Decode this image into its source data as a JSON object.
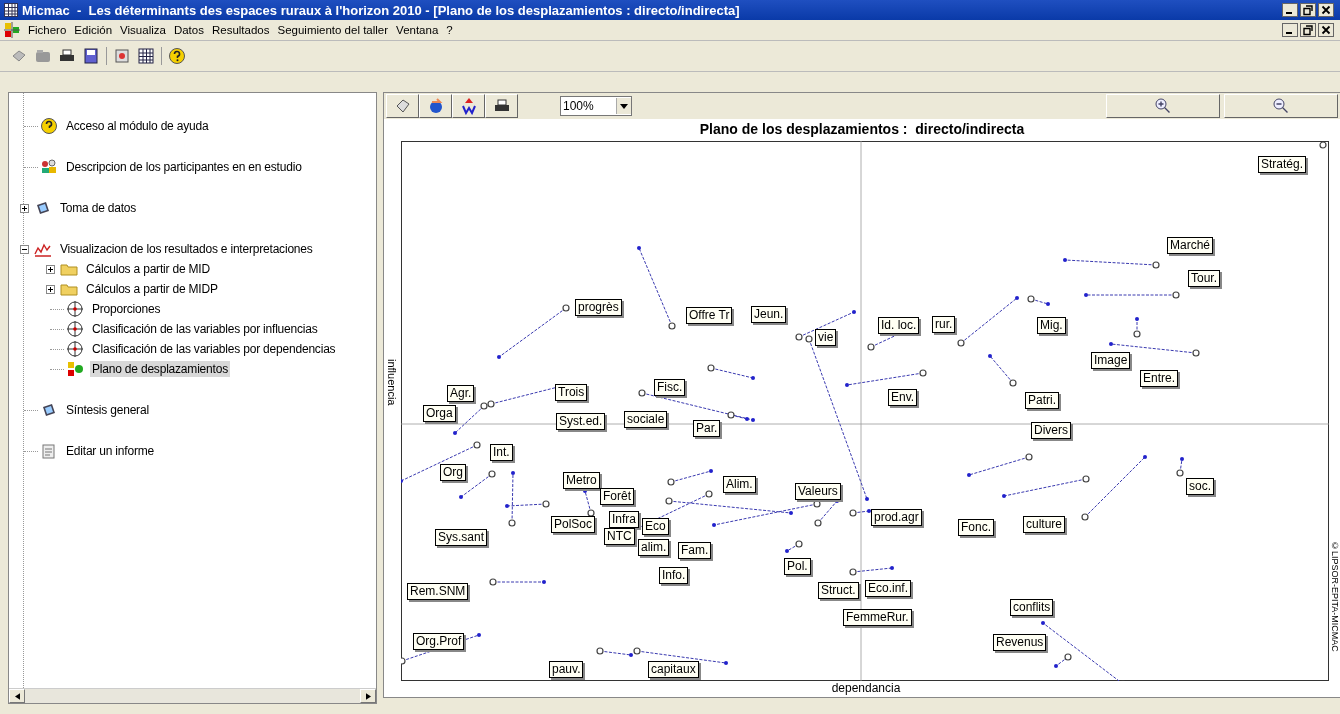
{
  "window": {
    "title": "Micmac  -  Les déterminants des espaces ruraux à l'horizon 2010 - [Plano de los desplazamientos : directo/indirecta]"
  },
  "menu": [
    "Fichero",
    "Edición",
    "Visualiza",
    "Datos",
    "Resultados",
    "Seguimiento del taller",
    "Ventana",
    "?"
  ],
  "tree": {
    "items": [
      {
        "label": "Acceso al módulo de ayuda",
        "kind": "help",
        "selected": false
      },
      {
        "label": "Descripcion de los participantes en en estudio",
        "kind": "people",
        "selected": false
      },
      {
        "label": "Toma de datos",
        "kind": "data",
        "selected": false,
        "expanded": false
      },
      {
        "label": "Visualizacion de los resultados e interpretaciones",
        "kind": "chart",
        "selected": false,
        "expanded": true,
        "children": [
          {
            "label": "Cálculos a partir de MID",
            "kind": "folder",
            "selected": false,
            "expanded": false
          },
          {
            "label": "Cálculos a partir de MIDP",
            "kind": "folder",
            "selected": false,
            "expanded": false
          },
          {
            "label": "Proporciones",
            "kind": "target",
            "selected": false
          },
          {
            "label": "Clasificación de las variables por influencias",
            "kind": "target",
            "selected": false
          },
          {
            "label": "Clasificación de las variables por dependencias",
            "kind": "target",
            "selected": false
          },
          {
            "label": "Plano de desplazamientos",
            "kind": "plan",
            "selected": true
          }
        ]
      },
      {
        "label": "Síntesis general",
        "kind": "data",
        "selected": false
      },
      {
        "label": "Editar un informe",
        "kind": "report",
        "selected": false
      }
    ]
  },
  "viewer": {
    "zoom": "100%",
    "title": "Plano de los desplazamientos :  directo/indirecta",
    "y_axis": "influencia",
    "x_axis": "dependancia",
    "copyright": "©LIPSOR-EPITA-MICMAC",
    "labels": [
      "Stratég.",
      "Marché",
      "Tour.",
      "progrès",
      "Offre Tr",
      "Jeun.",
      "vie",
      "Id. loc.",
      "rur.",
      "Mig.",
      "Image",
      "Entre.",
      "Agr.",
      "Trois",
      "Fisc.",
      "Orga",
      "Env.",
      "Patri.",
      "Syst.ed.",
      "sociale",
      "Par.",
      "Divers",
      "Int.",
      "Org",
      "Alim.",
      "Metro",
      "Valeurs",
      "Forêt",
      "soc.",
      "PolSoc",
      "Infra",
      "Eco",
      "prod.agr",
      "NTC",
      "Sys.sant",
      "Fonc.",
      "culture",
      "alim.",
      "Fam.",
      "Pol.",
      "Info.",
      "Rem.SNM",
      "Struct.",
      "Eco.inf.",
      "FemmeRur.",
      "conflits",
      "Revenus",
      "Org.Prof",
      "pauv.",
      "capitaux"
    ]
  }
}
